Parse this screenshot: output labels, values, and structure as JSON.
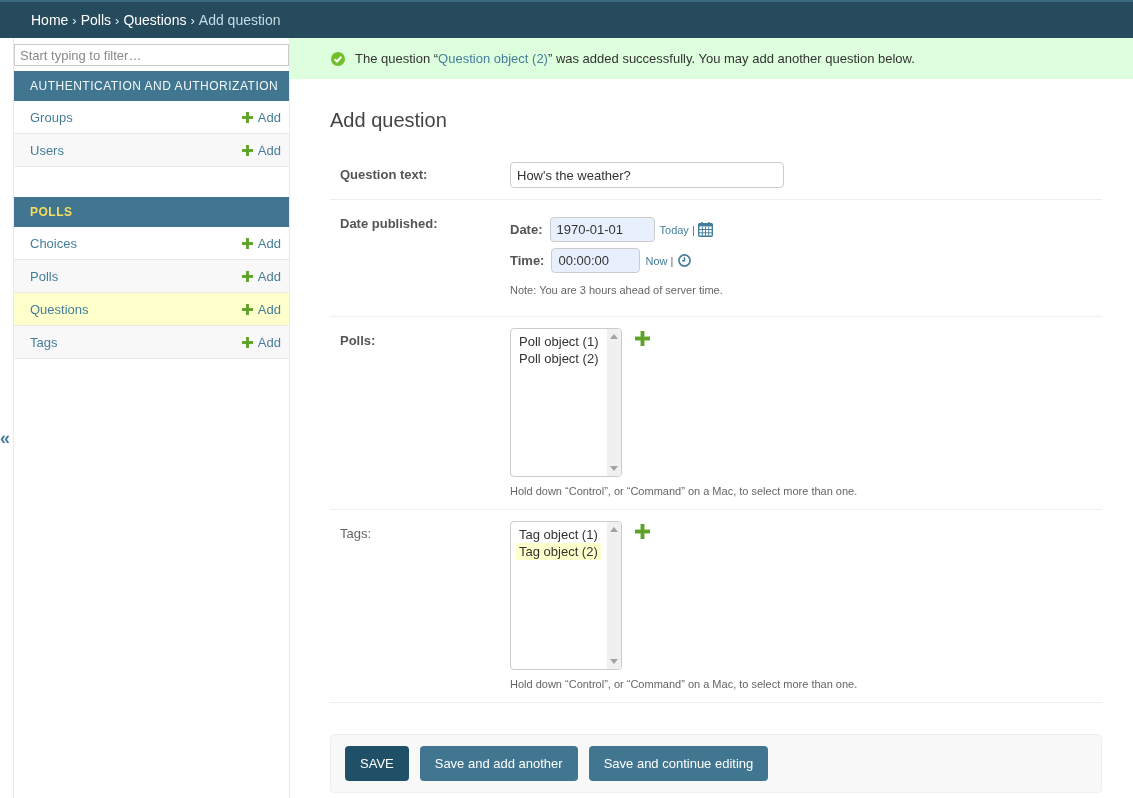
{
  "breadcrumbs": [
    {
      "kind": "link",
      "label": "Home"
    },
    {
      "kind": "separator",
      "label": "›"
    },
    {
      "kind": "link",
      "label": "Polls"
    },
    {
      "kind": "separator",
      "label": "›"
    },
    {
      "kind": "link",
      "label": "Questions"
    },
    {
      "kind": "separator",
      "label": "›"
    },
    {
      "kind": "current",
      "label": "Add question"
    }
  ],
  "nav_toggle": "«",
  "sidebar": {
    "filter": {
      "placeholder": "Start typing to filter…"
    },
    "apps": [
      {
        "caption": "AUTHENTICATION AND AUTHORIZATION",
        "selected": false,
        "models": [
          {
            "name": "Groups",
            "add": "Add",
            "selected": false
          },
          {
            "name": "Users",
            "add": "Add",
            "selected": false
          }
        ]
      },
      {
        "caption": "POLLS",
        "selected": true,
        "models": [
          {
            "name": "Choices",
            "add": "Add",
            "selected": false
          },
          {
            "name": "Polls",
            "add": "Add",
            "selected": false
          },
          {
            "name": "Questions",
            "add": "Add",
            "selected": true
          },
          {
            "name": "Tags",
            "add": "Add",
            "selected": false
          }
        ]
      }
    ]
  },
  "message": {
    "text_before": "The question “",
    "link": "Question object (2)",
    "text_after": "” was added successfully. You may add another question below."
  },
  "title": "Add question",
  "form": {
    "rows": [
      {
        "kind": "text",
        "label": "Question text:",
        "required": true,
        "value": "How's the weather?"
      },
      {
        "kind": "datetime",
        "label": "Date published:",
        "required": true,
        "parts": [
          {
            "kind": "date",
            "label": "Date:",
            "value": "1970-01-01",
            "shortcut": "Today",
            "separator": "|"
          },
          {
            "kind": "time",
            "label": "Time:",
            "value": "00:00:00",
            "shortcut": "Now",
            "separator": "|"
          }
        ],
        "help": "Note: You are 3 hours ahead of server time."
      },
      {
        "kind": "multiselect",
        "label": "Polls:",
        "required": true,
        "options": [
          {
            "label": "Poll object (1)",
            "selected": false
          },
          {
            "label": "Poll object (2)",
            "selected": false
          }
        ],
        "help": "Hold down “Control”, or “Command” on a Mac, to select more than one."
      },
      {
        "kind": "multiselect",
        "label": "Tags:",
        "required": false,
        "options": [
          {
            "label": "Tag object (1)",
            "selected": false
          },
          {
            "label": "Tag object (2)",
            "selected": true
          }
        ],
        "help": "Hold down “Control”, or “Command” on a Mac, to select more than one."
      }
    ]
  },
  "buttons": [
    {
      "label": "SAVE",
      "default": true
    },
    {
      "label": "Save and add another",
      "default": false
    },
    {
      "label": "Save and continue editing",
      "default": false
    }
  ]
}
